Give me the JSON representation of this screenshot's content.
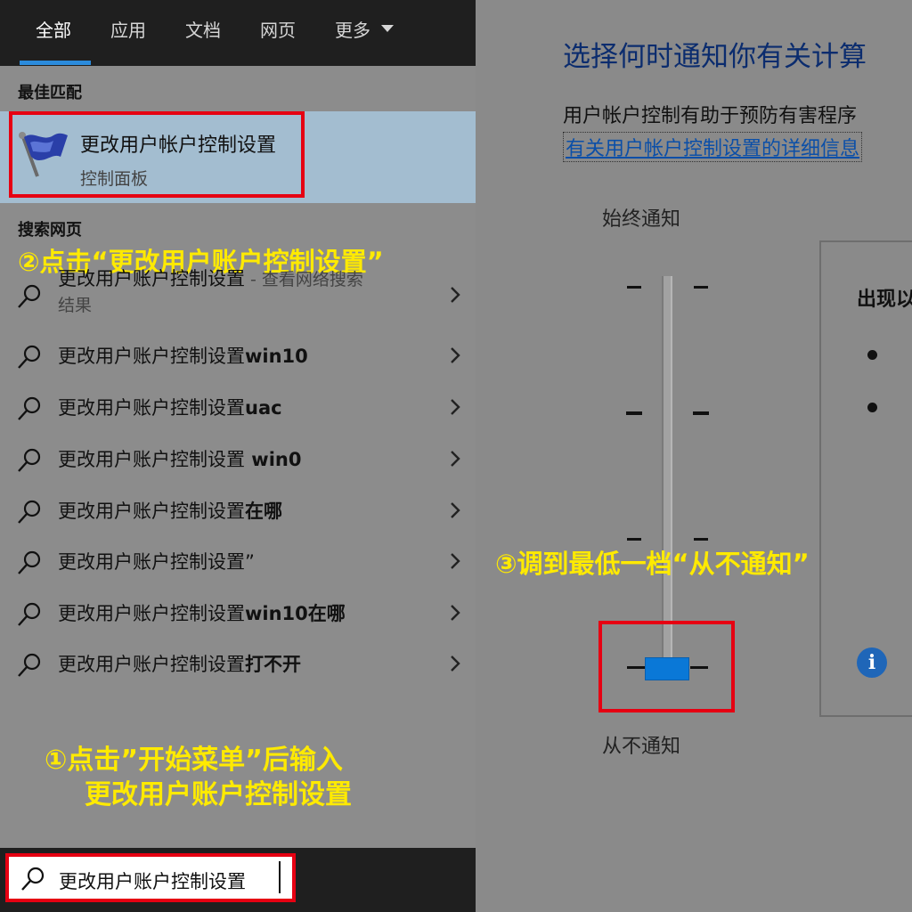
{
  "search_panel": {
    "tabs": [
      {
        "label": "全部"
      },
      {
        "label": "应用"
      },
      {
        "label": "文档"
      },
      {
        "label": "网页"
      },
      {
        "label": "更多"
      }
    ],
    "best_match_heading": "最佳匹配",
    "best_match": {
      "title": "更改用户帐户控制设置",
      "subtitle": "控制面板"
    },
    "web_heading": "搜索网页",
    "results": [
      {
        "prefix": "更改用户账户控制设置",
        "suffix": "",
        "hint": " - 查看网络搜索",
        "hint_line2": "结果"
      },
      {
        "prefix": "更改用户账户控制设置",
        "suffix": "win10"
      },
      {
        "prefix": "更改用户账户控制设置",
        "suffix": "uac"
      },
      {
        "prefix": "更改用户账户控制设置",
        "suffix": " win0"
      },
      {
        "prefix": "更改用户账户控制设置",
        "suffix": "在哪"
      },
      {
        "prefix": "更改用户账户控制设置",
        "suffix": "”"
      },
      {
        "prefix": "更改用户账户控制设置",
        "suffix": "win10在哪"
      },
      {
        "prefix": "更改用户账户控制设置",
        "suffix": "打不开"
      }
    ],
    "search_value": "更改用户账户控制设置"
  },
  "annotations": {
    "step1_line1": "①点击”开始菜单”后输入",
    "step1_line2": "更改用户账户控制设置",
    "step2": "②点击“更改用户账户控制设置”",
    "step3": "③调到最低一档“从不通知”"
  },
  "uac": {
    "heading": "选择何时通知你有关计算",
    "description": "用户帐户控制有助于预防有害程序",
    "link": "有关用户帐户控制设置的详细信息",
    "always_notify": "始终通知",
    "never_notify": "从不通知",
    "panel_title": "出现以",
    "slider_level": 0,
    "slider_levels": 4
  },
  "colors": {
    "highlight_box": "#e60012",
    "annotation": "#ffea00",
    "slider_thumb": "#0a78d7",
    "tab_underline": "#2b8bdc"
  }
}
